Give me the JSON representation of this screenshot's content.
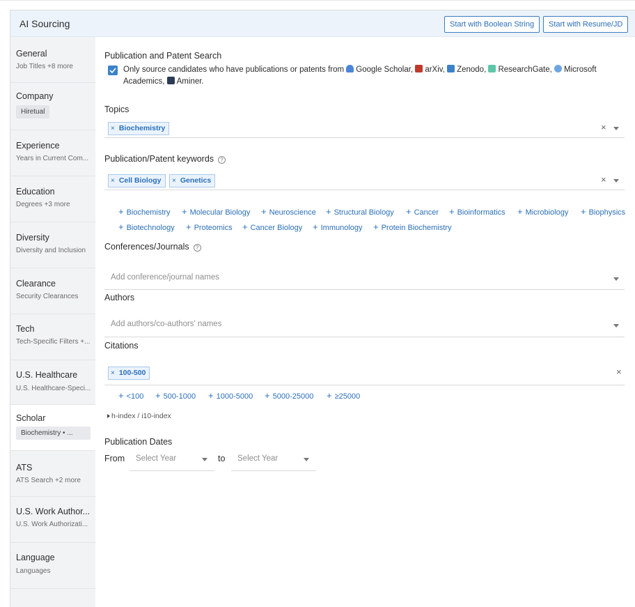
{
  "header": {
    "title": "AI Sourcing",
    "boolean_button": "Start with Boolean String",
    "resume_button": "Start with Resume/JD"
  },
  "sidebar": {
    "items": [
      {
        "title": "General",
        "sub": "Job Titles +8 more"
      },
      {
        "title": "Company",
        "chip": "Hiretual"
      },
      {
        "title": "Experience",
        "sub": "Years in Current Com..."
      },
      {
        "title": "Education",
        "sub": "Degrees +3 more"
      },
      {
        "title": "Diversity",
        "sub": "Diversity and Inclusion"
      },
      {
        "title": "Clearance",
        "sub": "Security Clearances"
      },
      {
        "title": "Tech",
        "sub": "Tech-Specific Filters +..."
      },
      {
        "title": "U.S. Healthcare",
        "sub": "U.S. Healthcare-Speci..."
      },
      {
        "title": "Scholar",
        "chip": "Biochemistry • ..."
      },
      {
        "title": "ATS",
        "sub": "ATS Search +2 more"
      },
      {
        "title": "U.S. Work Author...",
        "sub": "U.S. Work Authorizati..."
      },
      {
        "title": "Language",
        "sub": "Languages"
      }
    ]
  },
  "publication": {
    "heading": "Publication and Patent Search",
    "text_prefix": "Only source candidates who have publications or patents from",
    "sources": [
      {
        "name": "Google Scholar,",
        "color": "#4a86d8"
      },
      {
        "name": "arXiv,",
        "color": "#c0392b"
      },
      {
        "name": "Zenodo,",
        "color": "#3b82c9"
      },
      {
        "name": "ResearchGate,",
        "color": "#5cc7a8"
      },
      {
        "name": "Microsoft",
        "color": "#6ea7e0"
      }
    ],
    "line2_a": "Academics,",
    "aminer": "Aminer."
  },
  "topics": {
    "label": "Topics",
    "tags": [
      "Biochemistry"
    ]
  },
  "keywords": {
    "label": "Publication/Patent keywords",
    "tags": [
      "Cell Biology",
      "Genetics"
    ],
    "suggestions_row1": [
      "Biochemistry",
      "Molecular Biology",
      "Neuroscience",
      "Structural Biology",
      "Cancer",
      "Bioinformatics",
      "Microbiology",
      "Biophysics"
    ],
    "suggestions_row2": [
      "Biotechnology",
      "Proteomics",
      "Cancer Biology",
      "Immunology",
      "Protein Biochemistry"
    ]
  },
  "conferences": {
    "label": "Conferences/Journals",
    "placeholder": "Add conference/journal names"
  },
  "authors": {
    "label": "Authors",
    "placeholder": "Add authors/co-authors' names"
  },
  "citations": {
    "label": "Citations",
    "tags": [
      "100-500"
    ],
    "suggestions": [
      "<100",
      "500-1000",
      "1000-5000",
      "5000-25000",
      "≥25000"
    ],
    "hindex": "h-index / i10-index"
  },
  "dates": {
    "label": "Publication Dates",
    "from": "From",
    "to": "to",
    "from_placeholder": "Select Year",
    "to_placeholder": "Select Year"
  },
  "colors": {
    "accent": "#2b6fb8",
    "sidebar_bg": "#f2f3f5",
    "header_bg": "#edf3fa"
  }
}
